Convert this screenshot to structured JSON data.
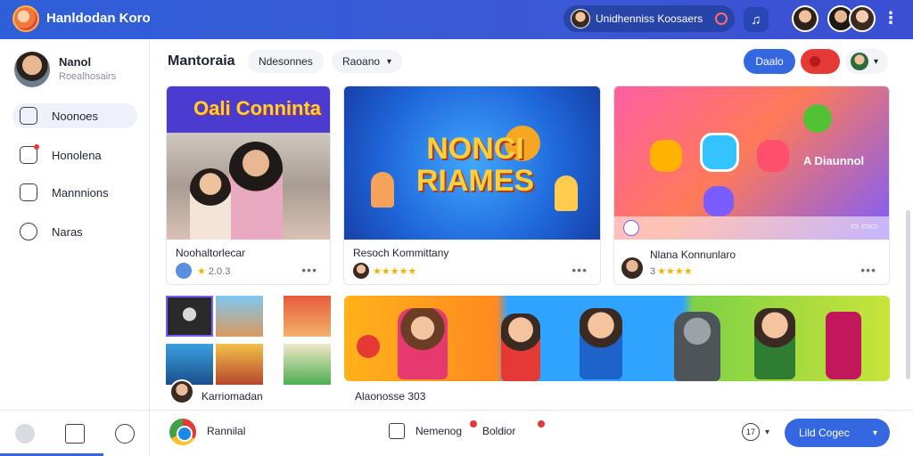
{
  "app": {
    "title": "Hanldodan Koro",
    "search_text": "Unidhenniss Koosaers"
  },
  "profile": {
    "name": "Nanol",
    "subtitle": "Roealhosairs"
  },
  "sidebar": {
    "items": [
      {
        "label": "Noonoes",
        "icon": "puzzle-icon",
        "active": true
      },
      {
        "label": "Honolena",
        "icon": "notification-icon",
        "active": false
      },
      {
        "label": "Mannnions",
        "icon": "list-icon",
        "active": false
      },
      {
        "label": "Naras",
        "icon": "chat-icon",
        "active": false
      }
    ]
  },
  "main": {
    "title": "Mantoraia",
    "chip_1": "Ndesonnes",
    "chip_2": "Raoano",
    "pill_blue": "Daalo"
  },
  "cards": [
    {
      "banner": "Oali Conninta",
      "title": "Noohaltorlecar",
      "rating": "2.0.3"
    },
    {
      "image_text": "NONCI RIAMES",
      "title": "Resoch Kommittany",
      "rating": ""
    },
    {
      "image_text": "A Diaunnol",
      "title": "Nlana Konnunlaro",
      "rating": "3"
    }
  ],
  "tiles": {
    "grid_caption": "Karriomadan",
    "wide_caption": "Alaonosse 303"
  },
  "bottombar": {
    "app_label": "Rannilal",
    "item_1": "Nemenog",
    "item_2": "Boldior",
    "round_label": "17",
    "primary_button": "Lild Cogec"
  },
  "colors": {
    "accent": "#3568e0",
    "topbar": "#2f5fd8",
    "star": "#f5b301",
    "badge": "#e53935"
  }
}
